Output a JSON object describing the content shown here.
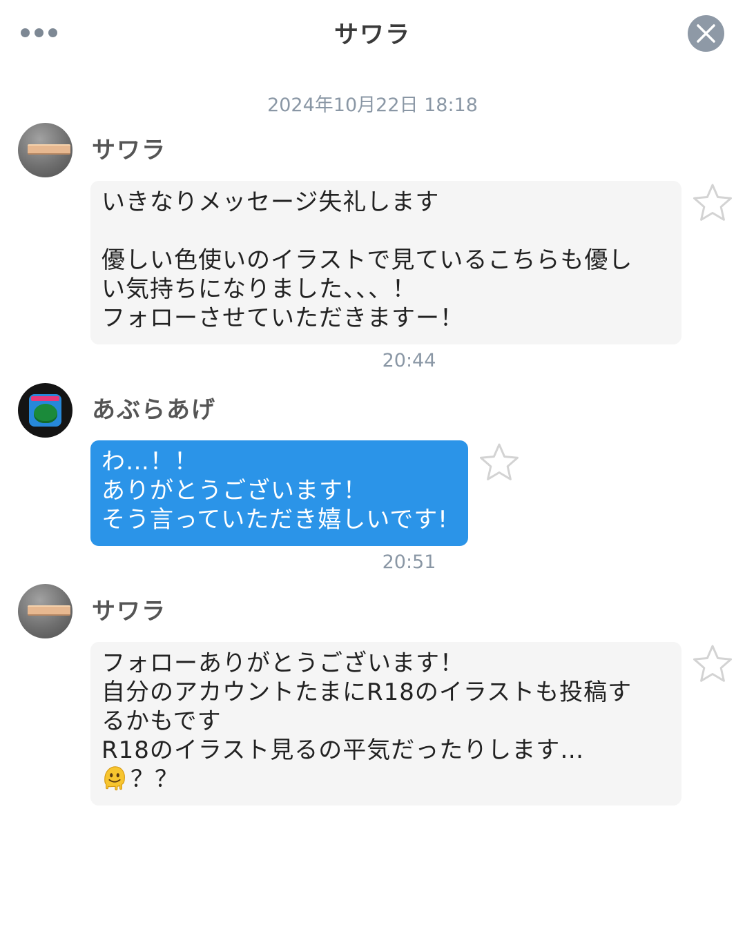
{
  "header": {
    "title": "サワラ",
    "more_icon": "more-horizontal-icon",
    "close_icon": "close-icon",
    "accent_color": "#8e99a6"
  },
  "conversation": {
    "date": "2024年10月22日 18:18",
    "messages": [
      {
        "sender": "サワラ",
        "avatar_icon": "sawara-avatar",
        "direction": "received",
        "lines": [
          "いきなりメッセージ失礼します",
          "",
          "優しい色使いのイラストで見ているこちらも優し",
          "い気持ちになりました、、、！",
          "フォローさせていただきますー！"
        ],
        "time": "20:44"
      },
      {
        "sender": "あぶらあげ",
        "avatar_icon": "aburaage-avatar",
        "direction": "sent",
        "lines": [
          "わ…！！",
          "ありがとうございます！",
          "そう言っていただき嬉しいです!"
        ],
        "time": "20:51",
        "bubble_color": "#2b94e8"
      },
      {
        "sender": "サワラ",
        "avatar_icon": "sawara-avatar",
        "direction": "received",
        "lines": [
          "フォローありがとうございます！",
          "自分のアカウントたまにR18のイラストも投稿す",
          "るかもです",
          "R18のイラスト見るの平気だったりします…"
        ],
        "last_line_text": "？？",
        "last_line_icon": "melting-face-emoji-icon"
      }
    ]
  }
}
